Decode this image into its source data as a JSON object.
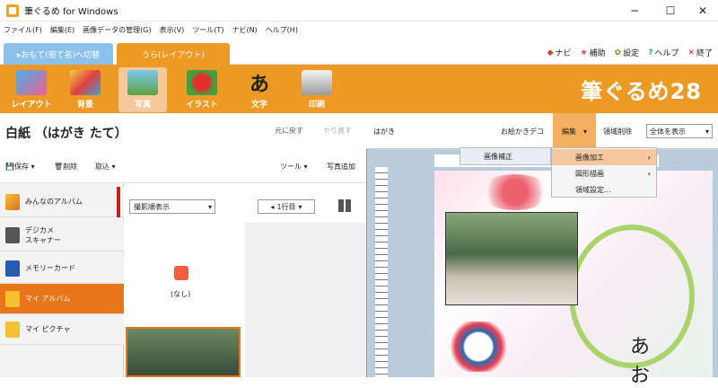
{
  "window": {
    "title": "筆ぐるめ for Windows",
    "minimize": "─",
    "maximize": "☐",
    "close": "✕"
  },
  "menu": [
    "ファイル(F)",
    "編集(E)",
    "画像データの管理(G)",
    "表示(V)",
    "ツール(T)",
    "ナビ(N)",
    "ヘルプ(H)"
  ],
  "tabs": {
    "front": "▸おもて(宛て名)へ切替",
    "back": "うら(レイアウト)"
  },
  "top_links": [
    {
      "icon": "diamond-icon",
      "label": "ナビ",
      "color": "#d04020"
    },
    {
      "icon": "star-icon",
      "label": "補助",
      "color": "#e0388a"
    },
    {
      "icon": "gear-icon",
      "label": "設定",
      "color": "#5fa030"
    },
    {
      "icon": "question-icon",
      "label": "ヘルプ",
      "color": "#2c8fd0"
    },
    {
      "icon": "close-icon",
      "label": "終了",
      "color": "#d02020"
    }
  ],
  "toolbar": [
    {
      "label": "レイアウト",
      "icon": "layout-icon"
    },
    {
      "label": "背景",
      "icon": "background-icon"
    },
    {
      "label": "写真",
      "icon": "photo-icon"
    },
    {
      "label": "イラスト",
      "icon": "illust-icon"
    },
    {
      "label": "文字",
      "icon": "text-icon"
    },
    {
      "label": "印刷",
      "icon": "printer-icon"
    }
  ],
  "brand": "筆ぐるめ28",
  "left": {
    "paper_title": "白紙 （はがき たて）",
    "undo": "元に戻す",
    "redo": "やり直す",
    "save": "保存",
    "delete": "削除",
    "import": "取込",
    "tool": "ツール",
    "add_photo": "写真追加"
  },
  "sidebar": [
    "みんなのアルバム",
    "デジカメ\nスキャナー",
    "メモリーカード",
    "マイ アルバム",
    "マイ ピクチャ"
  ],
  "middle": {
    "sort": "撮影順表示",
    "rows": "1行目",
    "none": "(なし)"
  },
  "right": {
    "paper": "はがき",
    "deco": "お絵かきデコ",
    "edit": "編集",
    "trim": "領域削除",
    "view": "全体を表示"
  },
  "popup1": [
    "画像補正"
  ],
  "popup2": [
    "画像加工",
    "図形描画",
    "領域設定..."
  ]
}
